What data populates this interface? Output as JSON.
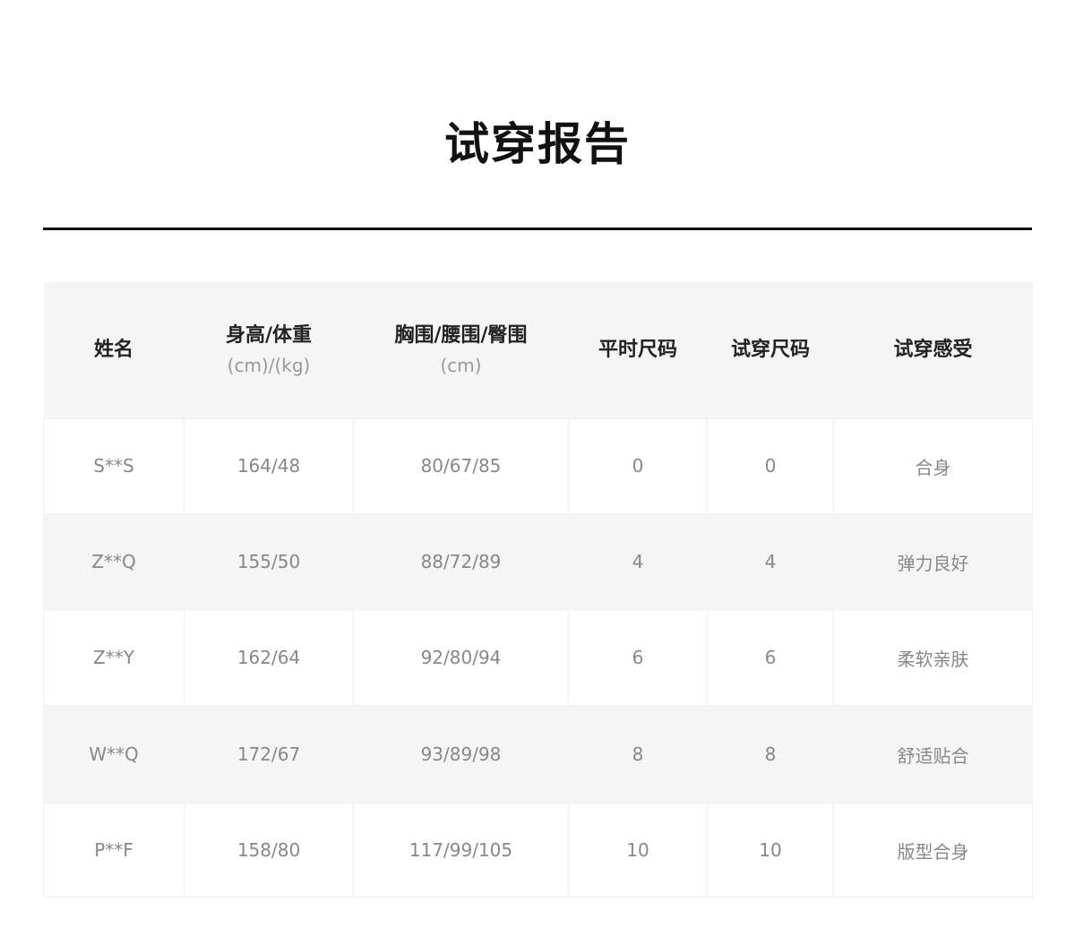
{
  "title": "试穿报告",
  "table": {
    "headers": [
      {
        "label": "姓名",
        "unit": ""
      },
      {
        "label": "身高/体重",
        "unit": "(cm)/(kg)"
      },
      {
        "label": "胸围/腰围/臀围",
        "unit": "(cm)"
      },
      {
        "label": "平时尺码",
        "unit": ""
      },
      {
        "label": "试穿尺码",
        "unit": ""
      },
      {
        "label": "试穿感受",
        "unit": ""
      }
    ],
    "rows": [
      [
        "S**S",
        "164/48",
        "80/67/85",
        "0",
        "0",
        "合身"
      ],
      [
        "Z**Q",
        "155/50",
        "88/72/89",
        "4",
        "4",
        "弹力良好"
      ],
      [
        "Z**Y",
        "162/64",
        "92/80/94",
        "6",
        "6",
        "柔软亲肤"
      ],
      [
        "W**Q",
        "172/67",
        "93/89/98",
        "8",
        "8",
        "舒适贴合"
      ],
      [
        "P**F",
        "158/80",
        "117/99/105",
        "10",
        "10",
        "版型合身"
      ]
    ]
  }
}
